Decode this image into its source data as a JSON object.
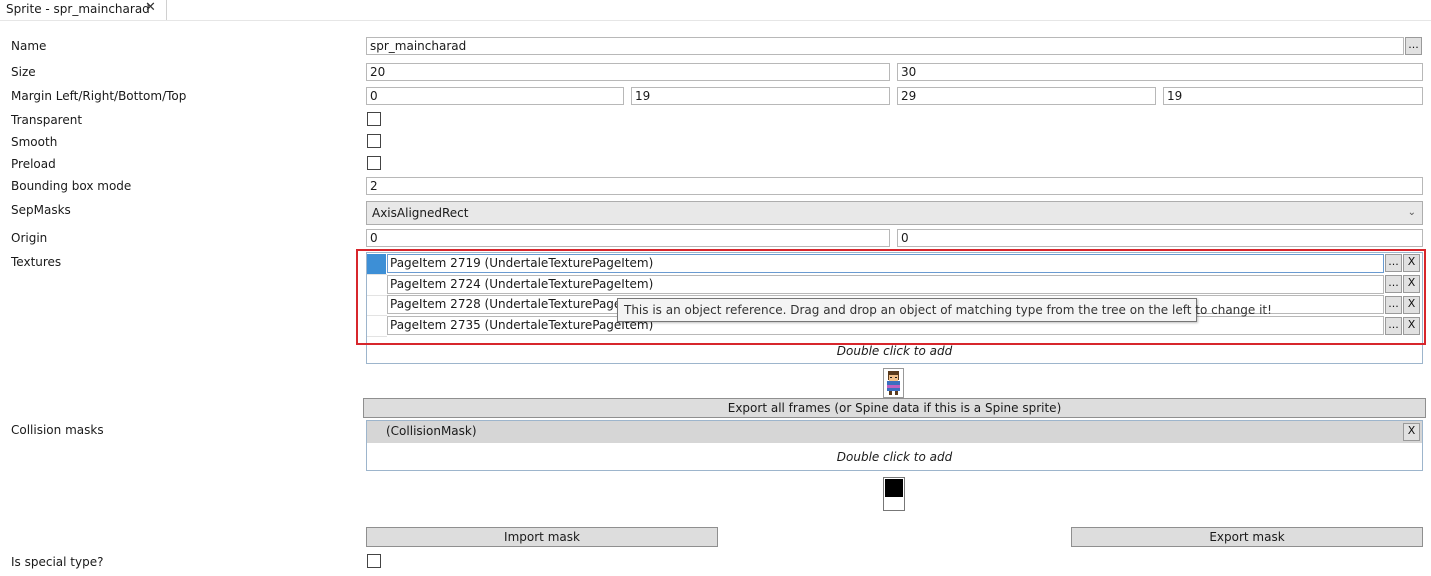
{
  "tab": {
    "title": "Sprite - spr_maincharad",
    "close_glyph": "✕"
  },
  "labels": {
    "name": "Name",
    "size": "Size",
    "margin": "Margin Left/Right/Bottom/Top",
    "transparent": "Transparent",
    "smooth": "Smooth",
    "preload": "Preload",
    "bbox_mode": "Bounding box mode",
    "sepmasks": "SepMasks",
    "origin": "Origin",
    "textures": "Textures",
    "collision_masks": "Collision masks",
    "special_type": "Is special type?"
  },
  "fields": {
    "name": "spr_maincharad",
    "size_w": "20",
    "size_h": "30",
    "margin_left": "0",
    "margin_right": "19",
    "margin_bottom": "29",
    "margin_top": "19",
    "bbox_mode": "2",
    "sepmasks": "AxisAlignedRect",
    "origin_x": "0",
    "origin_y": "0"
  },
  "checkboxes": {
    "transparent": false,
    "smooth": false,
    "preload": false,
    "special_type": false
  },
  "textures": [
    "PageItem 2719 (UndertaleTexturePageItem)",
    "PageItem 2724 (UndertaleTexturePageItem)",
    "PageItem 2728 (UndertaleTexturePageItem)",
    "PageItem 2735 (UndertaleTexturePageItem)"
  ],
  "buttons": {
    "browse": "...",
    "remove": "X",
    "export_frames": "Export all frames (or Spine data if this is a Spine sprite)",
    "import_mask": "Import mask",
    "export_mask": "Export mask"
  },
  "hints": {
    "double_click_add": "Double click to add"
  },
  "tooltip": "This is an object reference. Drag and drop an object of matching type from the tree on the left to change it!",
  "collision_mask_item": "(CollisionMask)",
  "colors": {
    "selection": "#3d8fd6",
    "highlight_frame": "#d7262c"
  },
  "icons": {
    "close": "close-icon",
    "dropdown": "chevron-down-icon",
    "sprite": "sprite-preview-icon"
  }
}
